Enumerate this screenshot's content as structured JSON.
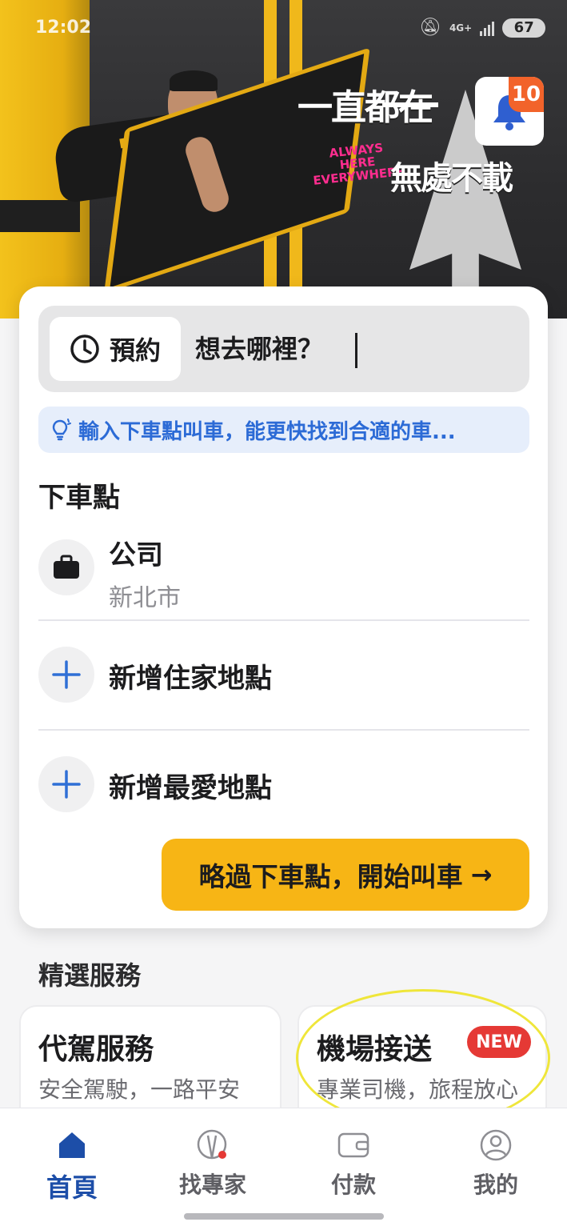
{
  "status_bar": {
    "time": "12:02",
    "network": "4G+",
    "battery": "67"
  },
  "hero": {
    "slogan_line1": "一直都在",
    "slogan_english": [
      "ALWAYS",
      "HERE",
      "EVERYWHERE"
    ],
    "slogan_line2": "無處不載"
  },
  "notification": {
    "icon": "bell-icon",
    "badge_count": "10"
  },
  "search": {
    "reserve_label": "預約",
    "placeholder": "想去哪裡？"
  },
  "tip": {
    "icon": "lightbulb-icon",
    "text": "輸入下車點叫車，能更快找到合適的車..."
  },
  "dropoff": {
    "section_title": "下車點",
    "saved": [
      {
        "icon": "briefcase-icon",
        "name": "公司",
        "address": "新北市"
      }
    ],
    "add_home": "新增住家地點",
    "add_favorite": "新增最愛地點"
  },
  "cta": {
    "label": "略過下車點，開始叫車",
    "arrow": "→"
  },
  "featured": {
    "title": "精選服務",
    "services": [
      {
        "title": "代駕服務",
        "subtitle": "安全駕駛，一路平安"
      },
      {
        "title": "機場接送",
        "subtitle": "專業司機，旅程放心",
        "badge": "NEW"
      }
    ]
  },
  "tabs": [
    {
      "label": "首頁",
      "icon": "home-icon",
      "active": true
    },
    {
      "label": "找專家",
      "icon": "expert-icon",
      "active": false
    },
    {
      "label": "付款",
      "icon": "wallet-icon",
      "active": false
    },
    {
      "label": "我的",
      "icon": "profile-icon",
      "active": false
    }
  ],
  "colors": {
    "accent_yellow": "#f7b515",
    "brand_blue": "#1d4ea8",
    "tip_blue": "#2c6bd6",
    "badge_orange": "#f2632a",
    "badge_red": "#e53935",
    "highlight_yellow": "#efe63a"
  }
}
